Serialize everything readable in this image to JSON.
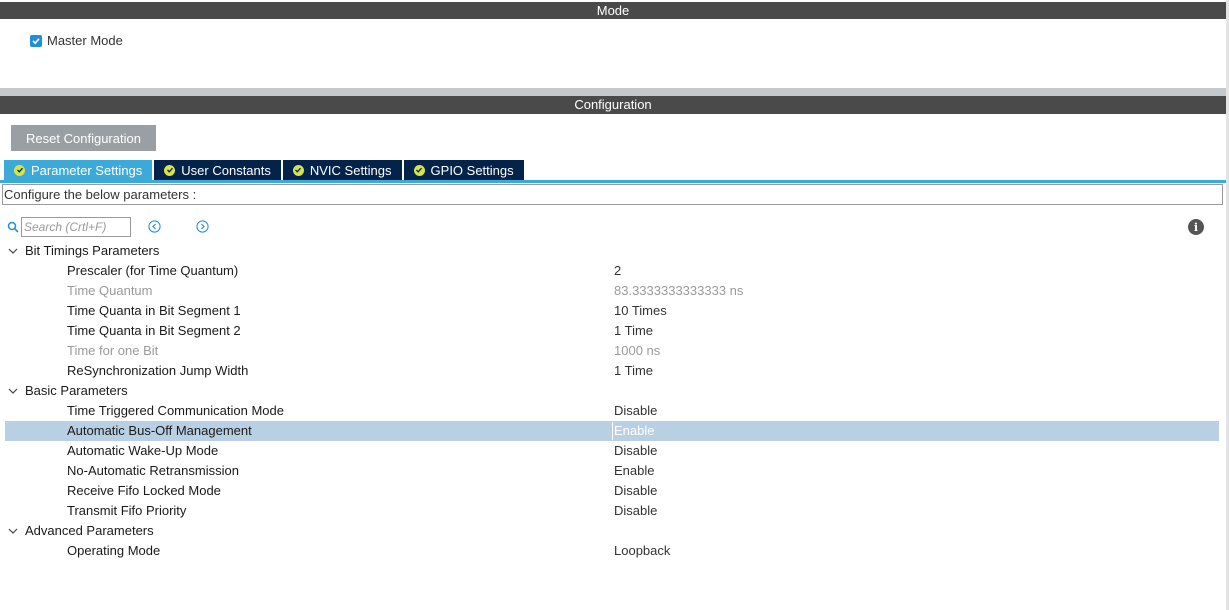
{
  "mode": {
    "title": "Mode",
    "master_mode_label": "Master Mode",
    "master_mode_checked": true
  },
  "configuration": {
    "title": "Configuration",
    "reset_label": "Reset Configuration",
    "tabs": [
      {
        "label": "Parameter Settings",
        "active": true
      },
      {
        "label": "User Constants",
        "active": false
      },
      {
        "label": "NVIC Settings",
        "active": false
      },
      {
        "label": "GPIO Settings",
        "active": false
      }
    ],
    "configure_text": "Configure the below parameters :",
    "search_placeholder": "Search (Crtl+F)"
  },
  "groups": [
    {
      "label": "Bit Timings Parameters",
      "params": [
        {
          "name": "Prescaler (for Time Quantum)",
          "value": "2",
          "readonly": false
        },
        {
          "name": "Time Quantum",
          "value": "83.3333333333333 ns",
          "readonly": true
        },
        {
          "name": "Time Quanta in Bit Segment 1",
          "value": "10 Times",
          "readonly": false
        },
        {
          "name": "Time Quanta in Bit Segment 2",
          "value": "1 Time",
          "readonly": false
        },
        {
          "name": "Time for one Bit",
          "value": "1000 ns",
          "readonly": true
        },
        {
          "name": "ReSynchronization Jump Width",
          "value": "1 Time",
          "readonly": false
        }
      ]
    },
    {
      "label": "Basic Parameters",
      "params": [
        {
          "name": "Time Triggered Communication Mode",
          "value": "Disable",
          "readonly": false
        },
        {
          "name": "Automatic Bus-Off Management",
          "value": "Enable",
          "readonly": false,
          "selected": true
        },
        {
          "name": "Automatic Wake-Up Mode",
          "value": "Disable",
          "readonly": false
        },
        {
          "name": "No-Automatic Retransmission",
          "value": "Enable",
          "readonly": false
        },
        {
          "name": "Receive Fifo Locked Mode",
          "value": "Disable",
          "readonly": false
        },
        {
          "name": "Transmit Fifo Priority",
          "value": "Disable",
          "readonly": false
        }
      ]
    },
    {
      "label": "Advanced Parameters",
      "params": [
        {
          "name": "Operating Mode",
          "value": "Loopback",
          "readonly": false
        }
      ]
    }
  ],
  "colors": {
    "header_bar": "#4a4a4a",
    "tab_active": "#3caad8",
    "tab_inactive": "#03234b",
    "selected_row": "#b9cfe4"
  },
  "icons": [
    "check-icon",
    "search-icon",
    "prev-icon",
    "next-icon",
    "info-icon",
    "chevron-down-icon"
  ]
}
